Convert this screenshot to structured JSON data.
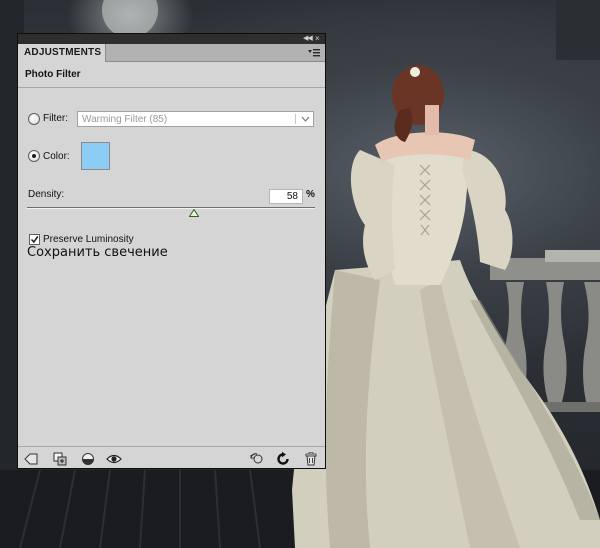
{
  "panel": {
    "tab_label": "ADJUSTMENTS",
    "heading": "Photo Filter"
  },
  "filter": {
    "label": "Filter:",
    "selected": "Warming Filter (85)"
  },
  "color": {
    "label": "Color:",
    "swatch_hex": "#8ccdf5"
  },
  "density": {
    "label": "Density:",
    "value": "58",
    "unit": "%",
    "level_percent": 58
  },
  "preserve_luminosity": {
    "label": "Preserve Luminosity",
    "checked": true
  },
  "note": "Сохранить свечение",
  "footer_icons": [
    "back-arrow-icon",
    "new-layer-icon",
    "clip-layer-icon",
    "visibility-eye-icon",
    "previous-state-icon",
    "reset-icon",
    "trash-icon"
  ]
}
